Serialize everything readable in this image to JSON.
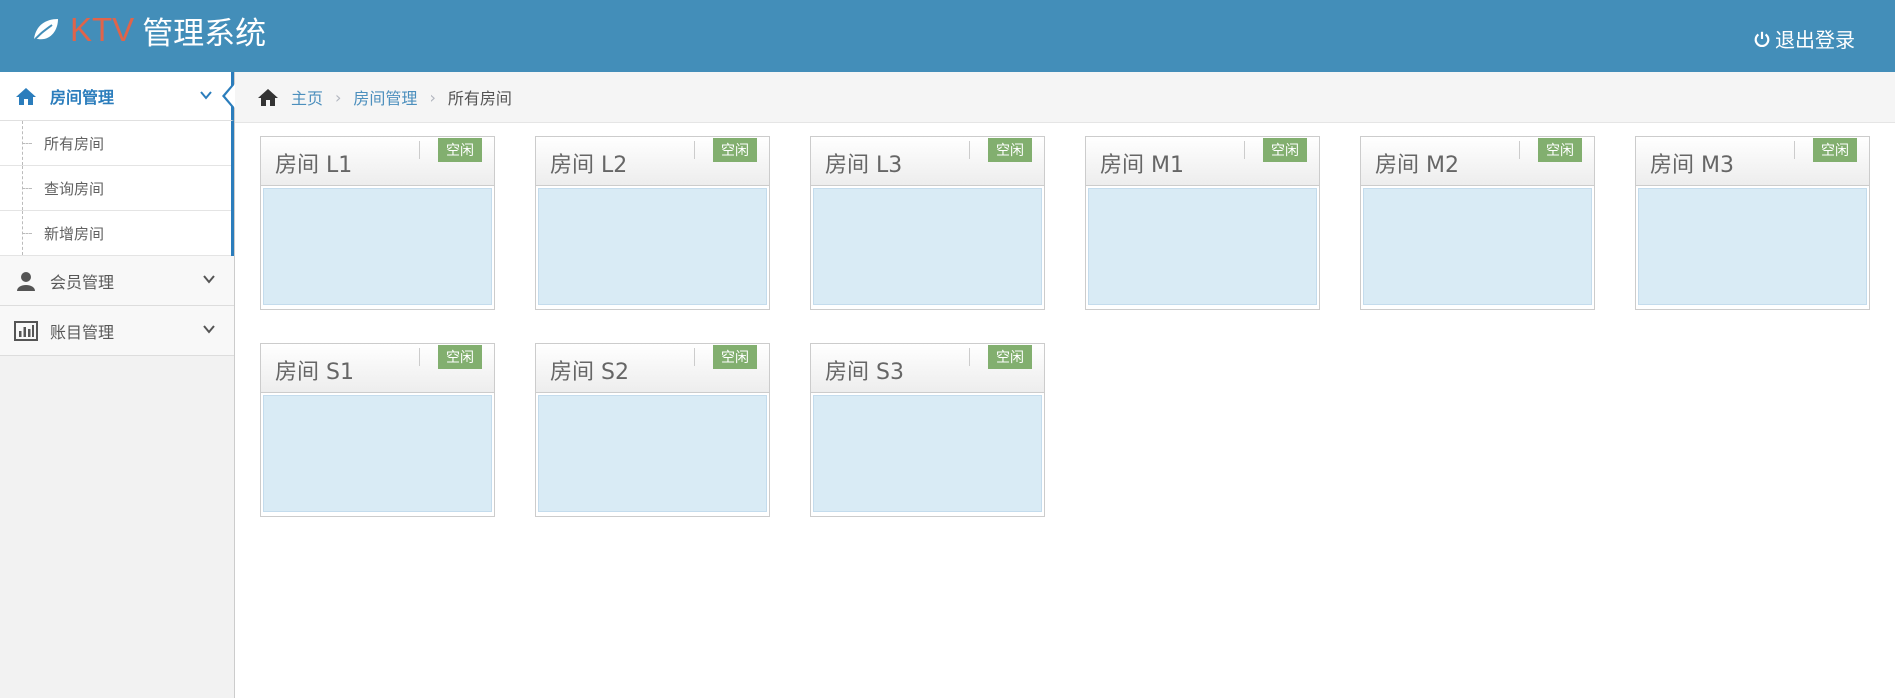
{
  "header": {
    "brand_ktv": "KTV",
    "brand_title": "管理系统",
    "logout_label": "退出登录"
  },
  "sidebar": {
    "items": [
      {
        "label": "房间管理",
        "icon": "home-icon",
        "active": true,
        "children": [
          "所有房间",
          "查询房间",
          "新增房间"
        ]
      },
      {
        "label": "会员管理",
        "icon": "user-icon"
      },
      {
        "label": "账目管理",
        "icon": "bar-chart-icon"
      }
    ]
  },
  "breadcrumb": {
    "home": "主页",
    "section": "房间管理",
    "current": "所有房间"
  },
  "rooms": [
    {
      "name": "房间 L1",
      "status": "空闲"
    },
    {
      "name": "房间 L2",
      "status": "空闲"
    },
    {
      "name": "房间 L3",
      "status": "空闲"
    },
    {
      "name": "房间 M1",
      "status": "空闲"
    },
    {
      "name": "房间 M2",
      "status": "空闲"
    },
    {
      "name": "房间 M3",
      "status": "空闲"
    },
    {
      "name": "房间 S1",
      "status": "空闲"
    },
    {
      "name": "房间 S2",
      "status": "空闲"
    },
    {
      "name": "房间 S3",
      "status": "空闲"
    }
  ],
  "colors": {
    "header": "#438eb9",
    "brand_accent": "#e0644a",
    "status_free": "#82af6f",
    "room_body": "#d9ebf5",
    "link": "#4c8fbd"
  }
}
